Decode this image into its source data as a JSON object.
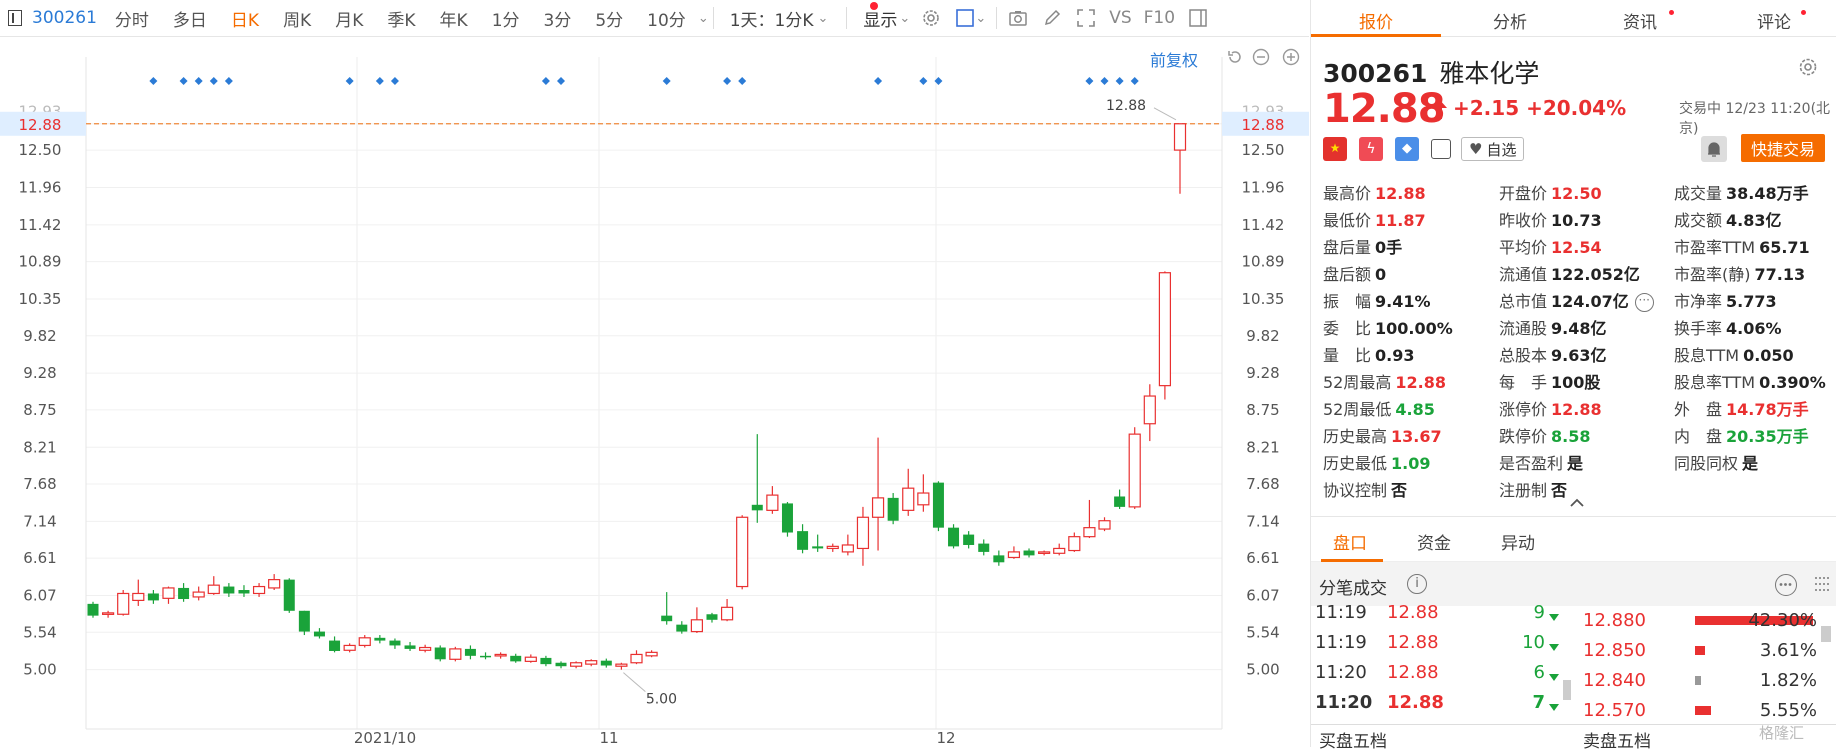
{
  "toolbar": {
    "code": "300261",
    "periods": [
      "分时",
      "多日",
      "日K",
      "周K",
      "月K",
      "季K",
      "年K",
      "1分",
      "3分",
      "5分",
      "10分"
    ],
    "active_period": "日K",
    "combo": "1天：1分K",
    "display": "显示",
    "vs": "VS",
    "f10": "F10",
    "fuquan": "前复权"
  },
  "chart": {
    "price_labels": [
      "12.88",
      "12.50",
      "11.96",
      "11.42",
      "10.89",
      "10.35",
      "9.82",
      "9.28",
      "8.75",
      "8.21",
      "7.68",
      "7.14",
      "6.61",
      "6.07",
      "5.54",
      "5.00"
    ],
    "top_label": "12.93",
    "current_marker": "12.88",
    "high_annotation": "12.88",
    "low_annotation": "5.00",
    "x_labels": [
      "2021/10",
      "11",
      "12"
    ]
  },
  "chart_data": {
    "type": "candlestick",
    "ylim": [
      4.75,
      13.05
    ],
    "note_indices": [
      4,
      6,
      7,
      8,
      9,
      17,
      19,
      20,
      30,
      31,
      38,
      42,
      43,
      52,
      55,
      56,
      66,
      67,
      68,
      69
    ],
    "candles": [
      [
        5.95,
        5.78,
        5.98,
        5.75
      ],
      [
        5.8,
        5.82,
        5.85,
        5.75
      ],
      [
        5.8,
        6.1,
        6.15,
        5.78
      ],
      [
        6.0,
        6.1,
        6.3,
        5.92
      ],
      [
        6.1,
        6.0,
        6.15,
        5.95
      ],
      [
        6.03,
        6.18,
        6.2,
        5.95
      ],
      [
        6.18,
        6.02,
        6.25,
        5.98
      ],
      [
        6.05,
        6.12,
        6.2,
        6.0
      ],
      [
        6.1,
        6.22,
        6.35,
        6.08
      ],
      [
        6.2,
        6.1,
        6.25,
        6.05
      ],
      [
        6.15,
        6.1,
        6.22,
        6.05
      ],
      [
        6.1,
        6.2,
        6.25,
        6.05
      ],
      [
        6.18,
        6.3,
        6.38,
        6.15
      ],
      [
        6.3,
        5.85,
        6.32,
        5.82
      ],
      [
        5.85,
        5.55,
        5.85,
        5.5
      ],
      [
        5.55,
        5.48,
        5.6,
        5.45
      ],
      [
        5.42,
        5.27,
        5.48,
        5.25
      ],
      [
        5.28,
        5.35,
        5.38,
        5.25
      ],
      [
        5.35,
        5.46,
        5.5,
        5.32
      ],
      [
        5.46,
        5.42,
        5.5,
        5.38
      ],
      [
        5.42,
        5.35,
        5.45,
        5.3
      ],
      [
        5.35,
        5.3,
        5.4,
        5.27
      ],
      [
        5.28,
        5.32,
        5.36,
        5.25
      ],
      [
        5.32,
        5.15,
        5.35,
        5.12
      ],
      [
        5.15,
        5.3,
        5.33,
        5.12
      ],
      [
        5.3,
        5.2,
        5.35,
        5.15
      ],
      [
        5.2,
        5.18,
        5.25,
        5.15
      ],
      [
        5.2,
        5.22,
        5.25,
        5.16
      ],
      [
        5.2,
        5.12,
        5.23,
        5.1
      ],
      [
        5.12,
        5.18,
        5.22,
        5.1
      ],
      [
        5.17,
        5.08,
        5.2,
        5.05
      ],
      [
        5.1,
        5.05,
        5.12,
        5.02
      ],
      [
        5.05,
        5.1,
        5.12,
        5.02
      ],
      [
        5.08,
        5.13,
        5.15,
        5.05
      ],
      [
        5.13,
        5.06,
        5.16,
        5.03
      ],
      [
        5.05,
        5.08,
        5.1,
        5.0
      ],
      [
        5.1,
        5.22,
        5.28,
        5.08
      ],
      [
        5.2,
        5.25,
        5.28,
        5.18
      ],
      [
        5.78,
        5.7,
        6.12,
        5.65
      ],
      [
        5.65,
        5.55,
        5.7,
        5.52
      ],
      [
        5.55,
        5.72,
        5.9,
        5.53
      ],
      [
        5.8,
        5.72,
        5.82,
        5.68
      ],
      [
        5.72,
        5.9,
        6.02,
        5.7
      ],
      [
        6.2,
        7.2,
        7.23,
        6.16
      ],
      [
        7.38,
        7.3,
        8.4,
        7.12
      ],
      [
        7.3,
        7.52,
        7.65,
        7.25
      ],
      [
        7.4,
        6.98,
        7.42,
        6.92
      ],
      [
        7.0,
        6.73,
        7.1,
        6.68
      ],
      [
        6.78,
        6.75,
        6.95,
        6.7
      ],
      [
        6.75,
        6.78,
        6.82,
        6.7
      ],
      [
        6.7,
        6.8,
        6.95,
        6.65
      ],
      [
        6.75,
        7.2,
        7.35,
        6.5
      ],
      [
        7.2,
        7.48,
        8.35,
        6.72
      ],
      [
        7.48,
        7.15,
        7.55,
        7.1
      ],
      [
        7.3,
        7.62,
        7.9,
        7.22
      ],
      [
        7.38,
        7.55,
        7.82,
        7.28
      ],
      [
        7.7,
        7.05,
        7.72,
        7.0
      ],
      [
        7.05,
        6.78,
        7.1,
        6.75
      ],
      [
        6.95,
        6.8,
        7.0,
        6.75
      ],
      [
        6.82,
        6.7,
        6.88,
        6.65
      ],
      [
        6.65,
        6.55,
        6.72,
        6.5
      ],
      [
        6.62,
        6.7,
        6.78,
        6.6
      ],
      [
        6.72,
        6.65,
        6.75,
        6.62
      ],
      [
        6.68,
        6.7,
        6.72,
        6.65
      ],
      [
        6.68,
        6.75,
        6.82,
        6.65
      ],
      [
        6.72,
        6.92,
        6.98,
        6.7
      ],
      [
        6.92,
        7.05,
        7.45,
        6.9
      ],
      [
        7.03,
        7.15,
        7.2,
        7.0
      ],
      [
        7.5,
        7.35,
        7.6,
        7.32
      ],
      [
        7.35,
        8.4,
        8.5,
        7.32
      ],
      [
        8.55,
        8.95,
        9.12,
        8.3
      ],
      [
        9.1,
        10.73,
        10.75,
        8.9
      ],
      [
        12.5,
        12.88,
        12.88,
        11.87
      ]
    ]
  },
  "right": {
    "tabs": [
      "报价",
      "分析",
      "资讯",
      "评论"
    ],
    "code": "300261",
    "name": "雅本化学",
    "price": "12.88",
    "change": "+2.15",
    "pct": "+20.04%",
    "status": "交易中 12/23 11:20(北京)",
    "zixuan": "自选",
    "quick_trade": "快捷交易",
    "cols": [
      [
        {
          "l": "最高价",
          "v": "12.88",
          "c": "red"
        },
        {
          "l": "最低价",
          "v": "11.87",
          "c": "red"
        },
        {
          "l": "盘后量",
          "v": "0手",
          "c": "black"
        },
        {
          "l": "盘后额",
          "v": "0",
          "c": "black"
        },
        {
          "l": "振　幅",
          "v": "9.41%",
          "c": "black"
        },
        {
          "l": "委　比",
          "v": "100.00%",
          "c": "black"
        },
        {
          "l": "量　比",
          "v": "0.93",
          "c": "black"
        },
        {
          "l": "52周最高",
          "v": "12.88",
          "c": "red"
        },
        {
          "l": "52周最低",
          "v": "4.85",
          "c": "green"
        },
        {
          "l": "历史最高",
          "v": "13.67",
          "c": "red"
        },
        {
          "l": "历史最低",
          "v": "1.09",
          "c": "green"
        },
        {
          "l": "协议控制",
          "v": "否",
          "c": "black"
        }
      ],
      [
        {
          "l": "开盘价",
          "v": "12.50",
          "c": "red"
        },
        {
          "l": "昨收价",
          "v": "10.73",
          "c": "black"
        },
        {
          "l": "平均价",
          "v": "12.54",
          "c": "red"
        },
        {
          "l": "流通值",
          "v": "122.052亿",
          "c": "black"
        },
        {
          "l": "总市值",
          "v": "124.07亿",
          "c": "black"
        },
        {
          "l": "流通股",
          "v": "9.48亿",
          "c": "black"
        },
        {
          "l": "总股本",
          "v": "9.63亿",
          "c": "black"
        },
        {
          "l": "每　手",
          "v": "100股",
          "c": "black"
        },
        {
          "l": "涨停价",
          "v": "12.88",
          "c": "red"
        },
        {
          "l": "跌停价",
          "v": "8.58",
          "c": "green"
        },
        {
          "l": "是否盈利",
          "v": "是",
          "c": "black"
        },
        {
          "l": "注册制",
          "v": "否",
          "c": "black"
        }
      ],
      [
        {
          "l": "成交量",
          "v": "38.48万手",
          "c": "black"
        },
        {
          "l": "成交额",
          "v": "4.83亿",
          "c": "black"
        },
        {
          "l": "市盈率TTM",
          "v": "65.71",
          "c": "black"
        },
        {
          "l": "市盈率(静)",
          "v": "77.13",
          "c": "black"
        },
        {
          "l": "市净率",
          "v": "5.773",
          "c": "black"
        },
        {
          "l": "换手率",
          "v": "4.06%",
          "c": "black"
        },
        {
          "l": "股息TTM",
          "v": "0.050",
          "c": "black"
        },
        {
          "l": "股息率TTM",
          "v": "0.390%",
          "c": "black"
        },
        {
          "l": "外　盘",
          "v": "14.78万手",
          "c": "red"
        },
        {
          "l": "内　盘",
          "v": "20.35万手",
          "c": "green"
        },
        {
          "l": "同股同权",
          "v": "是",
          "c": "black"
        }
      ]
    ],
    "panel_tabs": [
      "盘口",
      "资金",
      "异动"
    ],
    "ticks_title": "分笔成交",
    "ticks": [
      {
        "t": "11:19",
        "p": "12.88",
        "v": "9"
      },
      {
        "t": "11:19",
        "p": "12.88",
        "v": "10"
      },
      {
        "t": "11:20",
        "p": "12.88",
        "v": "6"
      },
      {
        "t": "11:20",
        "p": "12.88",
        "v": "7"
      }
    ],
    "dist": [
      {
        "p": "12.880",
        "pct": "42.30%",
        "frac": 0.423
      },
      {
        "p": "12.850",
        "pct": "3.61%",
        "frac": 0.036
      },
      {
        "p": "12.840",
        "pct": "1.82%",
        "frac": 0.018
      },
      {
        "p": "12.570",
        "pct": "5.55%",
        "frac": 0.056
      }
    ],
    "bottom": [
      "买盘五档",
      "卖盘五档"
    ],
    "watermark": "格隆汇"
  }
}
